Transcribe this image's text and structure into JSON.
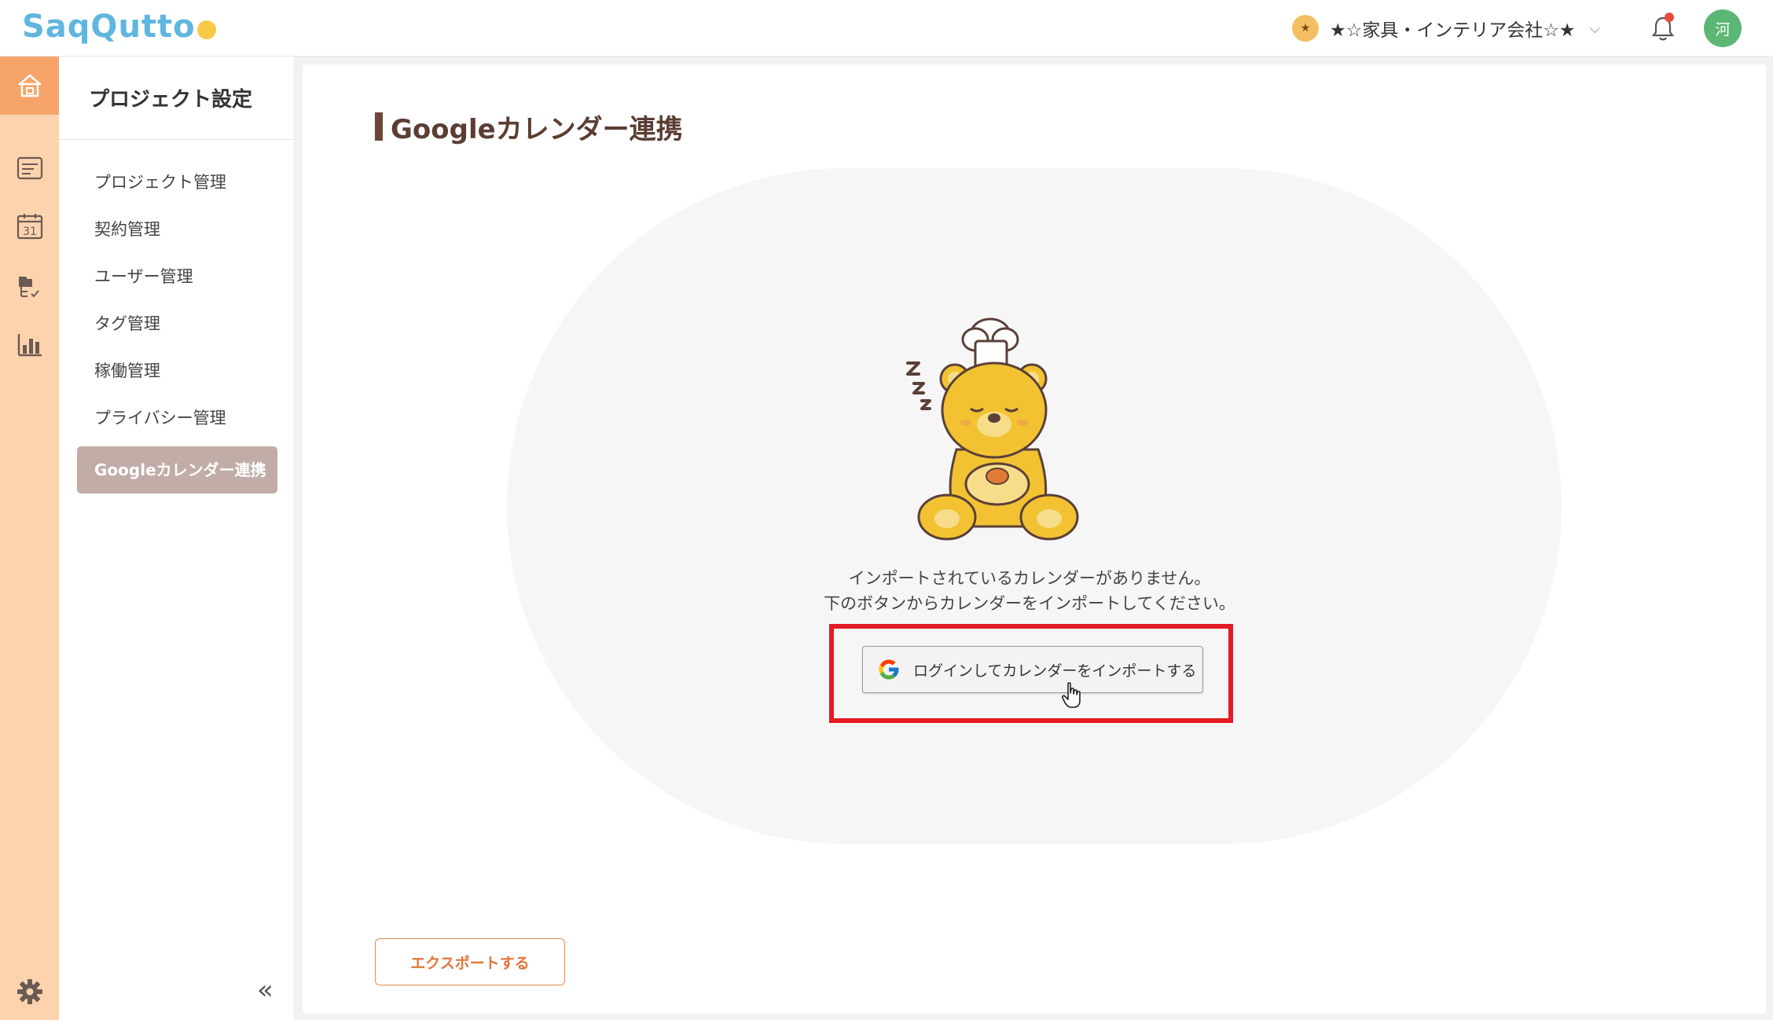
{
  "app": {
    "logo_text": "SaqQutto"
  },
  "header": {
    "org_badge": "★",
    "org_name": "★☆家具・インテリア会社☆★",
    "org_chevron": "⌵",
    "avatar_text": "河"
  },
  "rail": {
    "items": [
      "home-icon",
      "task-list-icon",
      "calendar-icon",
      "files-icon",
      "chart-icon"
    ],
    "calendar_day": "31",
    "gear": "settings-icon"
  },
  "sidebar": {
    "title": "プロジェクト設定",
    "items": [
      {
        "label": "プロジェクト管理"
      },
      {
        "label": "契約管理"
      },
      {
        "label": "ユーザー管理"
      },
      {
        "label": "タグ管理"
      },
      {
        "label": "稼働管理"
      },
      {
        "label": "プライバシー管理"
      },
      {
        "label": "Googleカレンダー連携"
      }
    ],
    "collapse_label": "«"
  },
  "main": {
    "title": "Googleカレンダー連携",
    "empty_line1": "インポートされているカレンダーがありません。",
    "empty_line2": "下のボタンからカレンダーをインポートしてください。",
    "google_button_label": "ログインしてカレンダーをインポートする",
    "export_button_label": "エクスポートする"
  },
  "colors": {
    "accent": "#f6a46a",
    "rail_bg": "#fdd3ae",
    "active_item": "#c1aca7",
    "title_color": "#5b3d33",
    "highlight": "#e31b23",
    "export": "#e2763a"
  }
}
